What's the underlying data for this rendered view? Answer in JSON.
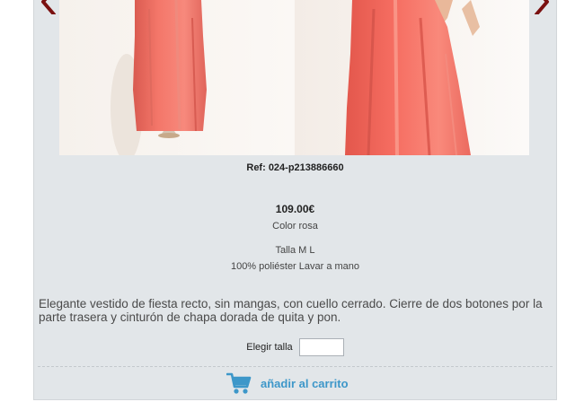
{
  "product": {
    "ref": "Ref: 024-p213886660",
    "price": "109.00€",
    "color": "Color rosa",
    "sizes": "Talla M L",
    "material": "100% poliéster Lavar a mano",
    "description": "Elegante vestido de fiesta recto, sin mangas, con cuello cerrado. Cierre de dos botones por la parte trasera y cinturón de chapa dorada de quita y pon."
  },
  "size_selector": {
    "label": "Elegir talla",
    "value": ""
  },
  "cart": {
    "button_label": "añadir al carrito",
    "icon": "shopping-cart-icon"
  },
  "gallery": {
    "prev_icon": "chevron-left-icon",
    "next_icon": "chevron-right-icon"
  },
  "colors": {
    "panel": "#e2e6e9",
    "dress": "#f4776a",
    "arrow": "#7a1010",
    "cart_accent": "#3d97c9"
  }
}
